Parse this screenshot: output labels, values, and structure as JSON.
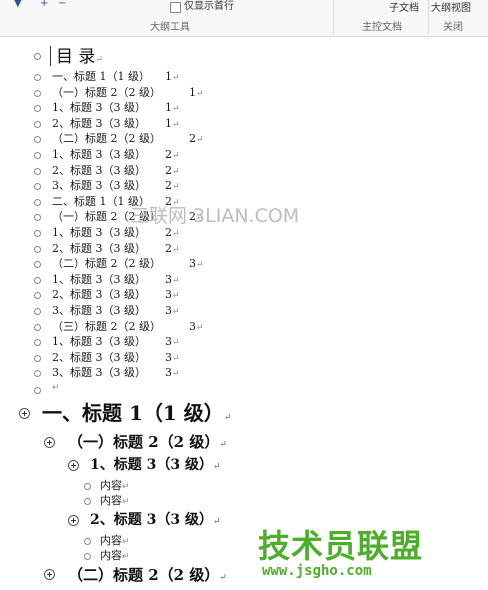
{
  "ribbon": {
    "show_first_line_label": "仅显示首行",
    "subdoc_label": "子文档",
    "close_view_label": "大纲视图",
    "group_outline_tools": "大纲工具",
    "group_master_doc": "主控文档",
    "group_close": "关闭"
  },
  "toc": {
    "title": "目  录",
    "entries": [
      {
        "text": "一、标题 1（1 级）",
        "page": "1"
      },
      {
        "text": "（一）标题 2（2 级）",
        "page": "1"
      },
      {
        "text": "1、标题 3（3 级）",
        "page": "1"
      },
      {
        "text": "2、标题 3（3 级）",
        "page": "1"
      },
      {
        "text": "（二）标题 2（2 级）",
        "page": "2"
      },
      {
        "text": "1、标题 3（3 级）",
        "page": "2"
      },
      {
        "text": "2、标题 3（3 级）",
        "page": "2"
      },
      {
        "text": "3、标题 3（3 级）",
        "page": "2"
      },
      {
        "text": "二、标题 1（1 级）",
        "page": "2"
      },
      {
        "text": "（一）标题 2（2 级）",
        "page": "2"
      },
      {
        "text": "1、标题 3（3 级）",
        "page": "2"
      },
      {
        "text": "2、标题 3（3 级）",
        "page": "2"
      },
      {
        "text": "（二）标题 2（2 级）",
        "page": "3"
      },
      {
        "text": "1、标题 3（3 级）",
        "page": "3"
      },
      {
        "text": "2、标题 3（3 级）",
        "page": "3"
      },
      {
        "text": "3、标题 3（3 级）",
        "page": "3"
      },
      {
        "text": "（三）标题 2（2 级）",
        "page": "3"
      },
      {
        "text": "1、标题 3（3 级）",
        "page": "3"
      },
      {
        "text": "2、标题 3（3 级）",
        "page": "3"
      },
      {
        "text": "3、标题 3（3 级）",
        "page": "3"
      }
    ]
  },
  "paragraph_mark": "↵",
  "outline": {
    "h1": "一、标题 1（1 级）",
    "h2_a": "（一）标题 2（2 级）",
    "h3_a": "1、标题 3（3 级）",
    "content_1": "内容",
    "content_2": "内容",
    "h3_b": "2、标题 3（3 级）",
    "content_3": "内容",
    "content_4": "内容",
    "h2_b": "（二）标题 2（2 级）"
  },
  "watermarks": {
    "site1": "三联网 3LIAN.COM",
    "site2_name": "技术员联盟",
    "site2_url": "www.jsgho.com"
  }
}
